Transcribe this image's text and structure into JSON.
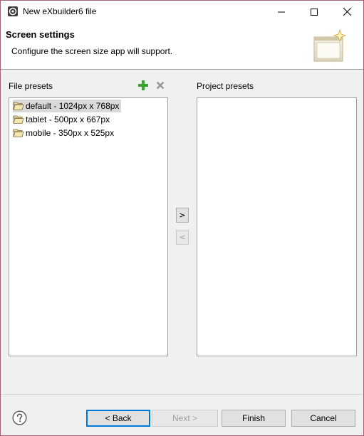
{
  "window": {
    "title": "New eXbuilder6 file"
  },
  "header": {
    "title": "Screen settings",
    "description": "Configure the screen size app will support."
  },
  "file_presets": {
    "label": "File presets",
    "items": [
      {
        "label": "default - 1024px x 768px",
        "selected": true
      },
      {
        "label": "tablet - 500px x 667px",
        "selected": false
      },
      {
        "label": "mobile - 350px x 525px",
        "selected": false
      }
    ]
  },
  "project_presets": {
    "label": "Project presets",
    "items": []
  },
  "transfer": {
    "move_right": ">",
    "move_left": "<"
  },
  "buttons": {
    "back": "< Back",
    "next": "Next >",
    "finish": "Finish",
    "cancel": "Cancel"
  },
  "icons": {
    "app": "exbuilder-app-icon",
    "add": "plus-icon",
    "delete": "x-icon",
    "folder": "open-folder-icon",
    "help": "help-icon",
    "header_graphic": "window-sparkle-icon"
  },
  "colors": {
    "window_border": "#a2637a",
    "add_green": "#3aa232",
    "default_button_border": "#0078d7"
  }
}
